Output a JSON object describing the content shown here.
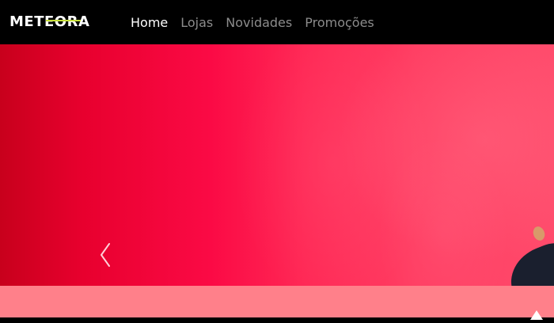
{
  "brand": {
    "logo_text": "METEORA",
    "logo_accent": "#c8e03a"
  },
  "nav": {
    "items": [
      {
        "label": "Home",
        "active": true
      },
      {
        "label": "Lojas",
        "active": false
      },
      {
        "label": "Novidades",
        "active": false
      },
      {
        "label": "Promoções",
        "active": false
      }
    ]
  },
  "hero": {
    "carousel_prev_icon": "chevron-left-icon"
  },
  "colors": {
    "navbar_bg": "#000000",
    "nav_active": "#ffffff",
    "nav_inactive": "#8c8c8c",
    "hero_red": "#f0083c",
    "band_pink": "#ff808a"
  }
}
